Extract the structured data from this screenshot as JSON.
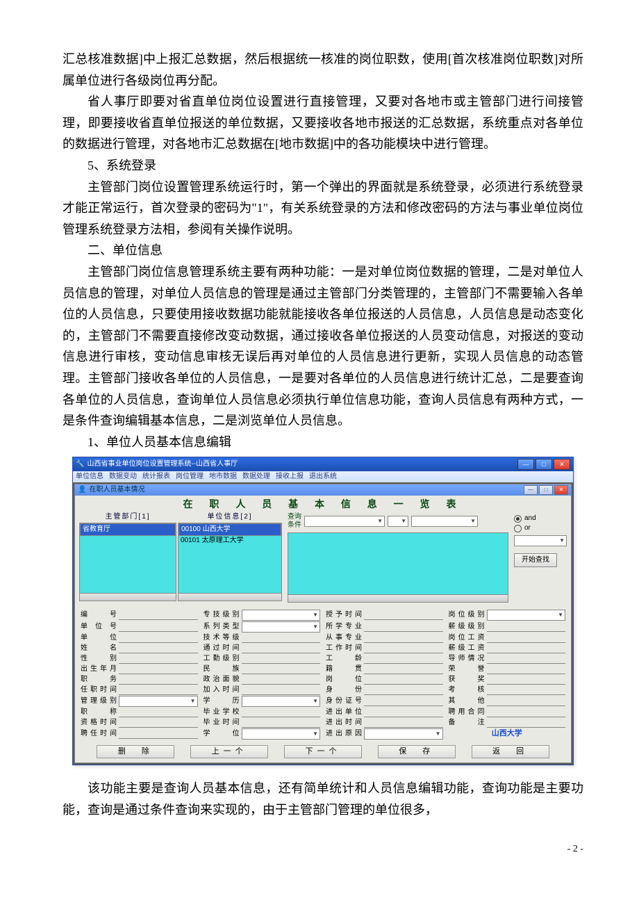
{
  "doc": {
    "p1": "汇总核准数据]中上报汇总数据，然后根据统一核准的岗位职数，使用[首次核准岗位职数]对所属单位进行各级岗位再分配。",
    "p2": "省人事厅即要对省直单位岗位设置进行直接管理，又要对各地市或主管部门进行间接管理，即要接收省直单位报送的单位数据，又要接收各地市报送的汇总数据，系统重点对各单位的数据进行管理，对各地市汇总数据在[地市数据]中的各功能模块中进行管理。",
    "s5": "5、系统登录",
    "p3": "主管部门岗位设置管理系统运行时，第一个弹出的界面就是系统登录，必须进行系统登录才能正常运行，首次登录的密码为\"1\"，有关系统登录的方法和修改密码的方法与事业单位岗位管理系统登录方法相，参阅有关操作说明。",
    "h2": "二、单位信息",
    "p4": "主管部门岗位信息管理系统主要有两种功能：一是对单位岗位数据的管理，二是对单位人员信息的管理，对单位人员信息的管理是通过主管部门分类管理的，主管部门不需要输入各单位的人员信息，只要使用接收数据功能就能接收各单位报送的人员信息，人员信息是动态变化的，主管部门不需要直接修改变动数据，通过接收各单位报送的人员变动信息，对报送的变动信息进行审核，变动信息审核无误后再对单位的人员信息进行更新，实现人员信息的动态管理。主管部门接收各单位的人员信息，一是要对各单位的人员信息进行统计汇总，二是要查询各单位的人员信息，查询单位人员信息必须执行单位信息功能，查询人员信息有两种方式，一是条件查询编辑基本信息，二是浏览单位人员信息。",
    "s1": "1、单位人员基本信息编辑",
    "p5": "该功能主要是查询人员基本信息，还有简单统计和人员信息编辑功能，查询功能是主要功能，查询是通过条件查询来实现的，由于主管部门管理的单位很多，",
    "page_num": "- 2 -"
  },
  "app": {
    "title": "山西省事业单位岗位设置管理系统--山西省人事厅",
    "menu": [
      "单位信息",
      "数据变动",
      "统计报表",
      "岗位管理",
      "地市数据",
      "数据处理",
      "接收上报",
      "退出系统"
    ],
    "child_title": "在职人员基本情况",
    "banner": "在 职 人 员 基 本 信 息 一 览 表",
    "dept_label": "主管部门[1]",
    "dept_items": [
      "省教育厅"
    ],
    "unit_label": "单位信息[2]",
    "unit_items": [
      "00100  山西大学",
      "00101  太原理工大学"
    ],
    "query_label1": "查询",
    "query_label2": "条件",
    "and": "and",
    "or": "or",
    "search_btn": "开始查找",
    "labels": {
      "c1": [
        "编　　号",
        "单 位 号",
        "单　　位",
        "姓　　名",
        "性　　别",
        "出生年月",
        "职　　务",
        "任职时间",
        "管理级别",
        "职　　称",
        "资格时间",
        "聘任时间"
      ],
      "c2": [
        "专技级别",
        "系列类型",
        "技术等级",
        "通过时间",
        "工勤级别",
        "民　　族",
        "政治面貌",
        "加入时间",
        "学　　历",
        "毕业学校",
        "毕业时间",
        "学　　位"
      ],
      "c3": [
        "授予时间",
        "所学专业",
        "从事专业",
        "工作时间",
        "工　　龄",
        "籍　　贯",
        "岗　　位",
        "身　　份",
        "身份证号",
        "进出单位",
        "进出时间",
        "进出原因"
      ],
      "c4": [
        "岗位级别",
        "薪级级别",
        "岗位工资",
        "薪级工资",
        "导师情况",
        "荣　　誉",
        "获　　奖",
        "考　　核",
        "其　　他",
        "聘用合同",
        "备　　注"
      ]
    },
    "brand": "山西大学",
    "actions": [
      "删　除",
      "上一个",
      "下一个",
      "保　存",
      "返　回"
    ]
  }
}
